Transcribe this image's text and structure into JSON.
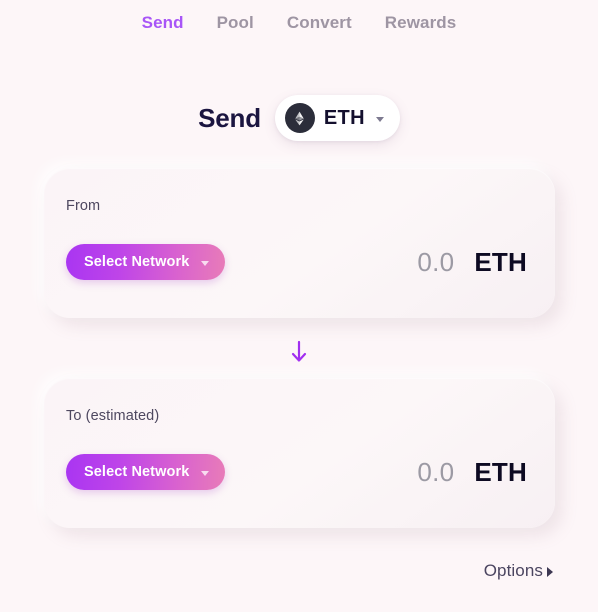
{
  "nav": {
    "tabs": [
      {
        "label": "Send",
        "active": true
      },
      {
        "label": "Pool",
        "active": false
      },
      {
        "label": "Convert",
        "active": false
      },
      {
        "label": "Rewards",
        "active": false
      }
    ]
  },
  "header": {
    "title": "Send",
    "token": {
      "symbol": "ETH",
      "logo_icon": "ethereum-logo-icon",
      "caret_icon": "chevron-down-icon"
    }
  },
  "cards": {
    "from": {
      "label": "From",
      "network_button": {
        "label": "Select Network",
        "caret_icon": "chevron-down-icon"
      },
      "amount": "0.0",
      "symbol": "ETH"
    },
    "to": {
      "label": "To (estimated)",
      "network_button": {
        "label": "Select Network",
        "caret_icon": "chevron-down-icon"
      },
      "amount": "0.0",
      "symbol": "ETH"
    }
  },
  "direction_arrow": {
    "icon": "arrow-down-icon",
    "color": "#a12ef0"
  },
  "footer": {
    "options_label": "Options",
    "options_caret_icon": "caret-right-icon"
  },
  "colors": {
    "accent": "#a855f7",
    "gradient_start": "#a935f2",
    "gradient_end": "#e87cb8",
    "background": "#fdf6f8",
    "inactive_tab": "#9e95a3"
  }
}
